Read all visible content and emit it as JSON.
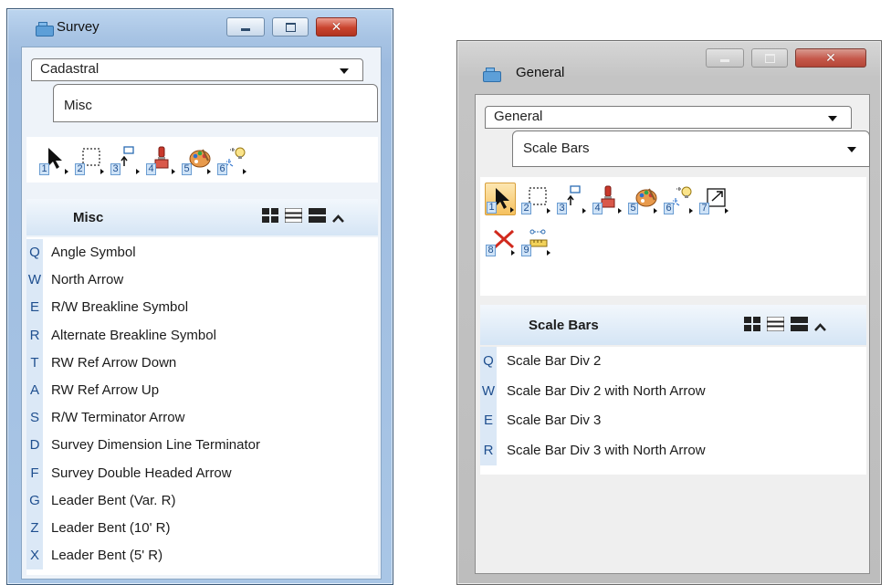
{
  "survey_window": {
    "title": "Survey",
    "tab_top": "Cadastral",
    "tab_sub": "Misc",
    "tools": [
      {
        "num": "1",
        "icon": "arrow-select-icon"
      },
      {
        "num": "2",
        "icon": "dashed-fence-icon"
      },
      {
        "num": "3",
        "icon": "place-point-icon"
      },
      {
        "num": "4",
        "icon": "paint-brush-icon"
      },
      {
        "num": "5",
        "icon": "palette-icon"
      },
      {
        "num": "6",
        "icon": "light-bulb-icon"
      }
    ],
    "section_title": "Misc",
    "items": [
      {
        "key": "Q",
        "label": "Angle Symbol"
      },
      {
        "key": "W",
        "label": "North Arrow"
      },
      {
        "key": "E",
        "label": "R/W Breakline Symbol"
      },
      {
        "key": "R",
        "label": "Alternate Breakline Symbol"
      },
      {
        "key": "T",
        "label": "RW Ref Arrow Down"
      },
      {
        "key": "A",
        "label": "RW Ref Arrow Up"
      },
      {
        "key": "S",
        "label": "R/W Terminator Arrow"
      },
      {
        "key": "D",
        "label": "Survey Dimension Line Terminator"
      },
      {
        "key": "F",
        "label": "Survey Double Headed Arrow"
      },
      {
        "key": "G",
        "label": "Leader Bent (Var. R)"
      },
      {
        "key": "Z",
        "label": "Leader Bent (10' R)"
      },
      {
        "key": "X",
        "label": "Leader Bent (5' R)"
      }
    ]
  },
  "general_window": {
    "title": "General",
    "tab_top": "General",
    "tab_sub": "Scale Bars",
    "tools": [
      {
        "num": "1",
        "icon": "arrow-select-icon"
      },
      {
        "num": "2",
        "icon": "dashed-fence-icon"
      },
      {
        "num": "3",
        "icon": "place-point-icon"
      },
      {
        "num": "4",
        "icon": "paint-brush-icon"
      },
      {
        "num": "5",
        "icon": "palette-icon"
      },
      {
        "num": "6",
        "icon": "light-bulb-icon"
      },
      {
        "num": "7",
        "icon": "scale-element-icon"
      },
      {
        "num": "8",
        "icon": "delete-x-icon"
      },
      {
        "num": "9",
        "icon": "measure-tape-icon"
      }
    ],
    "section_title": "Scale Bars",
    "items": [
      {
        "key": "Q",
        "label": "Scale Bar Div 2"
      },
      {
        "key": "W",
        "label": "Scale Bar Div 2 with North Arrow"
      },
      {
        "key": "E",
        "label": "Scale Bar Div 3"
      },
      {
        "key": "R",
        "label": "Scale Bar Div 3 with North Arrow"
      }
    ]
  },
  "colors": {
    "selected_tool": "#f6c15e",
    "key_column": "#dbe8f6",
    "section_header": "#d5e5f5"
  }
}
